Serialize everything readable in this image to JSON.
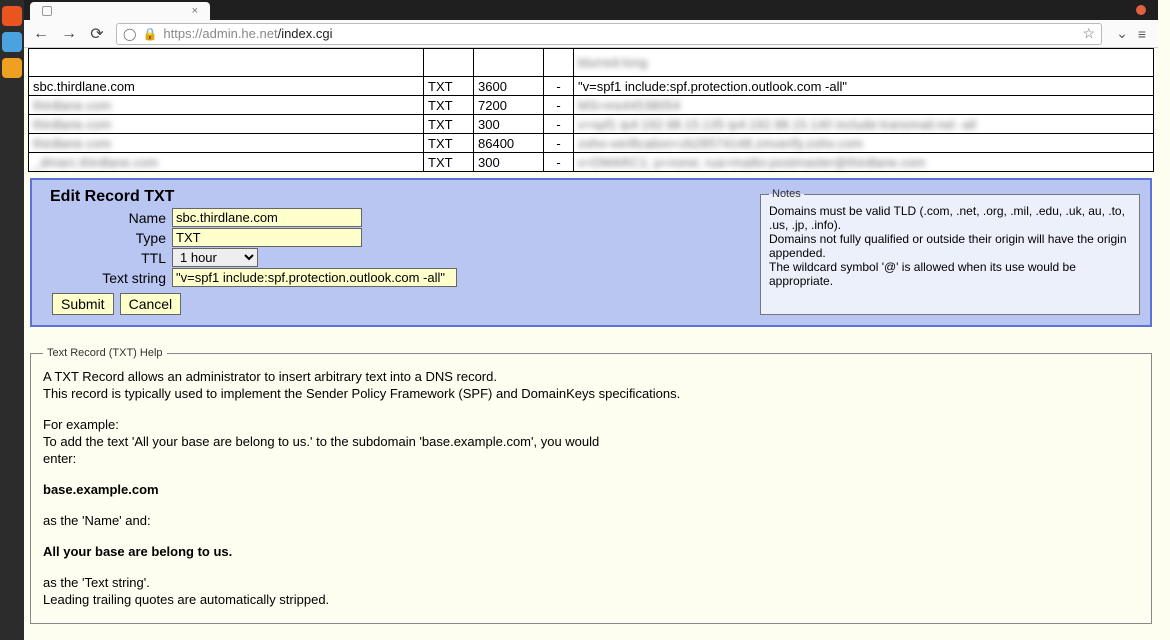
{
  "browser": {
    "tab_title": "",
    "url_scheme_host": "https://admin.he.net",
    "url_path": "/index.cgi"
  },
  "table": {
    "rows": [
      {
        "name": "",
        "type": "",
        "ttl": "",
        "dash": "",
        "data": "blurred-long",
        "blur_name": true,
        "blur_data": true,
        "tall": true
      },
      {
        "name": "sbc.thirdlane.com",
        "type": "TXT",
        "ttl": "3600",
        "dash": "-",
        "data": "\"v=spf1 include:spf.protection.outlook.com -all\"",
        "blur_name": false,
        "blur_data": false
      },
      {
        "name": "thirdlane.com",
        "type": "TXT",
        "ttl": "7200",
        "dash": "-",
        "data": "MS=ms44538054",
        "blur_name": true,
        "blur_data": true
      },
      {
        "name": "thirdlane.com",
        "type": "TXT",
        "ttl": "300",
        "dash": "-",
        "data": "v=spf1 ip4:192.98.15.135 ip4:192.98.15.140 include:transmail.net -all",
        "blur_name": true,
        "blur_data": true
      },
      {
        "name": "thirdlane.com",
        "type": "TXT",
        "ttl": "86400",
        "dash": "-",
        "data": "zoho-verification=zb28574148.zmverify.zoho.com",
        "blur_name": true,
        "blur_data": true
      },
      {
        "name": "_dmarc.thirdlane.com",
        "type": "TXT",
        "ttl": "300",
        "dash": "-",
        "data": "v=DMARC1; p=none; rua=mailto:postmaster@thirdlane.com",
        "blur_name": true,
        "blur_data": true
      }
    ]
  },
  "edit": {
    "title": "Edit Record TXT",
    "labels": {
      "name": "Name",
      "type": "Type",
      "ttl": "TTL",
      "text": "Text string"
    },
    "values": {
      "name": "sbc.thirdlane.com",
      "type": "TXT",
      "ttl": "1 hour",
      "text": "\"v=spf1 include:spf.protection.outlook.com -all\""
    },
    "buttons": {
      "submit": "Submit",
      "cancel": "Cancel"
    },
    "notes": {
      "legend": "Notes",
      "lines": [
        "Domains must be valid TLD (.com, .net, .org, .mil, .edu, .uk, au, .to, .us, .jp, .info).",
        "Domains not fully qualified or outside their origin will have the origin appended.",
        "The wildcard symbol '@' is allowed when its use would be appropriate."
      ]
    }
  },
  "help": {
    "legend": "Text Record (TXT) Help",
    "p1": "A TXT Record allows an administrator to insert arbitrary text into a DNS record.",
    "p2": "This record is typically used to implement the Sender Policy Framework (SPF) and DomainKeys specifications.",
    "p3": "For example:",
    "p4a": "To add the text 'All your base are belong to us.' to the subdomain 'base.example.com', you would",
    "p4b": "enter:",
    "b1": "base.example.com",
    "p5": "as the 'Name' and:",
    "b2": "All your base are belong to us.",
    "p6": "as the 'Text string'.",
    "p7": "Leading trailing quotes are automatically stripped."
  }
}
